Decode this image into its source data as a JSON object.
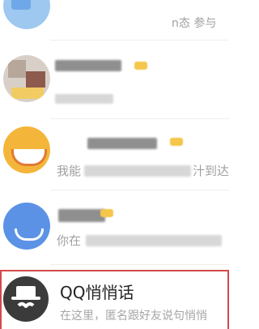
{
  "conversations": [
    {
      "subtitle_fragment": "n态  参与",
      "state": "pixelated"
    },
    {
      "subtitle_fragment": "",
      "state": "pixelated"
    },
    {
      "subtitle_prefix": "我能",
      "subtitle_suffix": "汁到达",
      "state": "pixelated"
    },
    {
      "subtitle_prefix": "你在",
      "subtitle_suffix": "",
      "state": "pixelated"
    }
  ],
  "whisper": {
    "title": "QQ悄悄话",
    "preview": "在这里，匿名跟好友说句悄悄",
    "highlight_color": "#d44a4a",
    "icon": "incognito-icon"
  }
}
